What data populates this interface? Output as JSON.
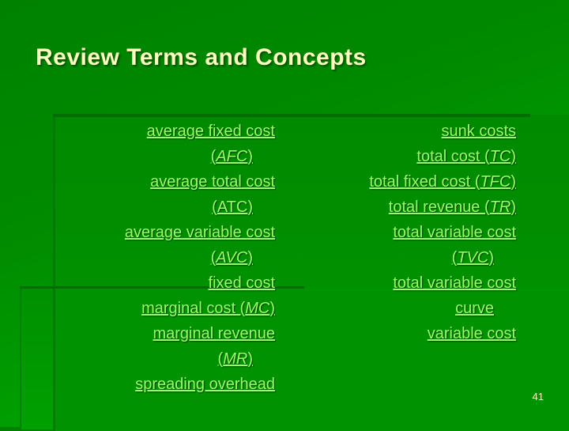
{
  "slide": {
    "title": "Review Terms and Concepts",
    "page_number": "41",
    "colors": {
      "title": "#ffffc0",
      "term_text": "#99ff66",
      "background": "#008a00"
    }
  },
  "left_terms": [
    {
      "text": "average fixed cost ",
      "line2_pre": "(",
      "abbr": "AFC",
      "abbr_italic": true,
      "line2_post": ")"
    },
    {
      "text": "average total cost ",
      "line2_pre": "(",
      "abbr": "ATC",
      "abbr_italic": false,
      "line2_post": ")"
    },
    {
      "text": "average variable cost ",
      "line2_pre": "(",
      "abbr": "AVC",
      "abbr_italic": true,
      "line2_post": ")"
    },
    {
      "text": "fixed cost"
    },
    {
      "text": "marginal cost (",
      "inline_abbr": "MC",
      "inline_post": ")"
    },
    {
      "text": "marginal revenue ",
      "line2_pre": "(",
      "abbr": "MR",
      "abbr_italic": true,
      "line2_post": ")"
    },
    {
      "text": "spreading overhead"
    }
  ],
  "right_terms": [
    {
      "text": "sunk costs"
    },
    {
      "text": "total cost (",
      "inline_abbr": "TC",
      "inline_post": ")"
    },
    {
      "text": "total fixed cost (",
      "inline_abbr": "TFC",
      "inline_post": ")"
    },
    {
      "text": "total revenue (",
      "inline_abbr": "TR",
      "inline_post": ")"
    },
    {
      "text": "total variable cost ",
      "line2_pre": "(",
      "abbr": "TVC",
      "abbr_italic": true,
      "line2_post": ")"
    },
    {
      "text": "total variable cost ",
      "line2_text": "curve"
    },
    {
      "text": "variable cost"
    }
  ]
}
